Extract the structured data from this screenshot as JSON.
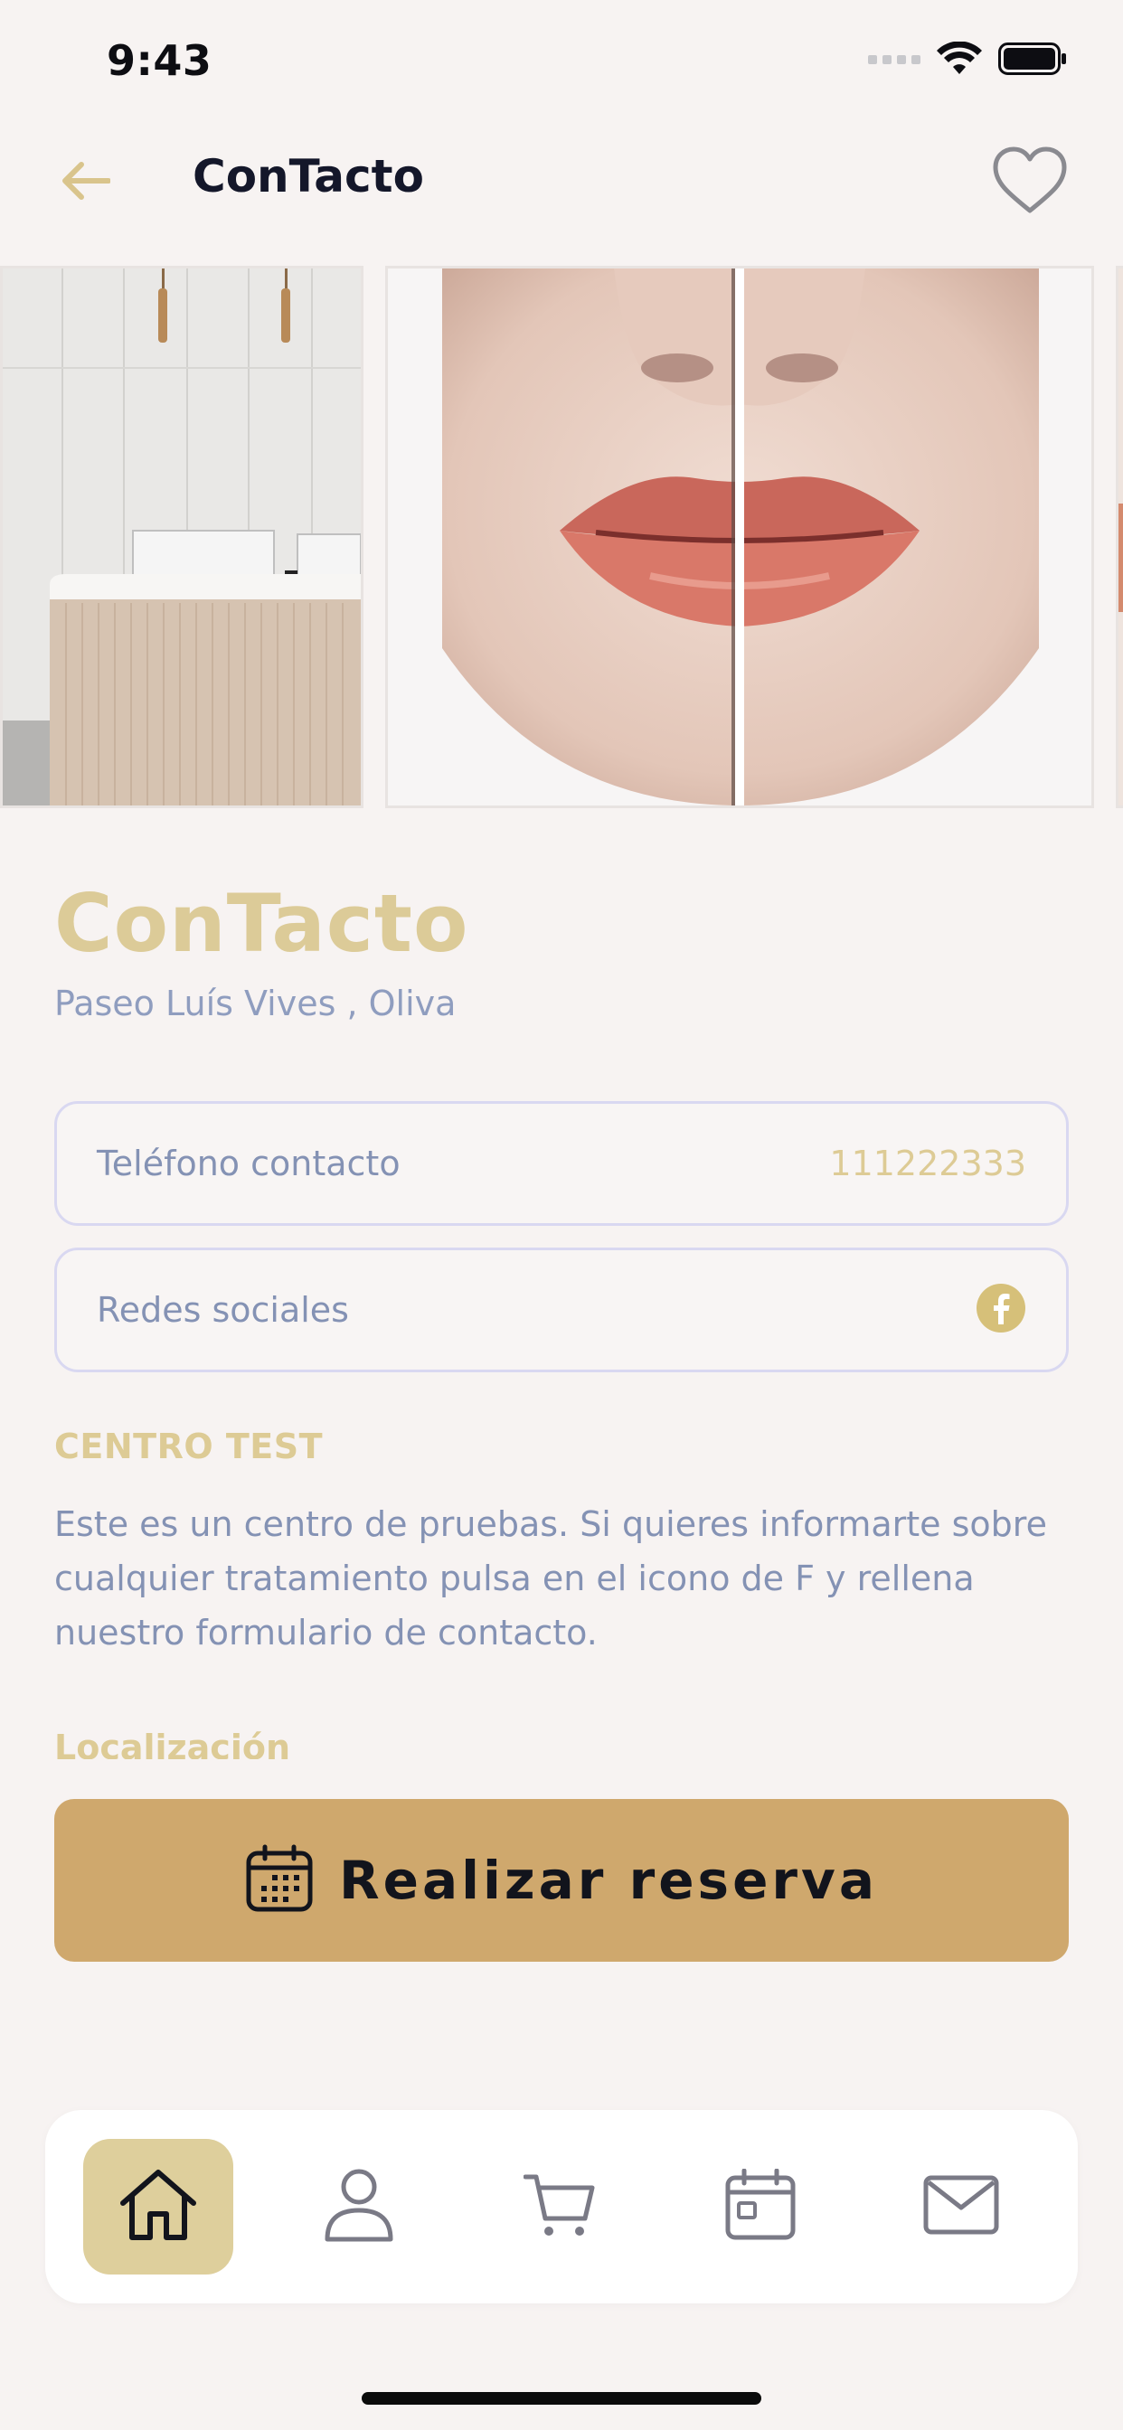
{
  "status_bar": {
    "time": "9:43"
  },
  "nav": {
    "title": "ConTacto"
  },
  "center": {
    "name": "ConTacto",
    "address": "Paseo Luís Vives , Oliva"
  },
  "contact": {
    "phone_label": "Teléfono contacto",
    "phone_value": "111222333",
    "social_label": "Redes sociales",
    "social_icon": "facebook-icon"
  },
  "about": {
    "title": "CENTRO TEST",
    "description": "Este es un centro de pruebas. Si quieres informarte sobre cualquier tratamiento pulsa en el icono de F y rellena nuestro formulario de contacto."
  },
  "location": {
    "title": "Localización"
  },
  "reserve_button": {
    "label": "Realizar reserva",
    "icon": "calendar-icon"
  },
  "tab_bar": {
    "items": [
      {
        "name": "home",
        "icon": "home-icon",
        "active": true
      },
      {
        "name": "profile",
        "icon": "user-icon",
        "active": false
      },
      {
        "name": "cart",
        "icon": "cart-icon",
        "active": false
      },
      {
        "name": "calendar",
        "icon": "calendar-icon",
        "active": false
      },
      {
        "name": "messages",
        "icon": "mail-icon",
        "active": false
      }
    ]
  },
  "colors": {
    "accent": "#dccb98",
    "button": "#cfa86d",
    "muted_text": "#8492b4",
    "background": "#f7f3f2"
  }
}
